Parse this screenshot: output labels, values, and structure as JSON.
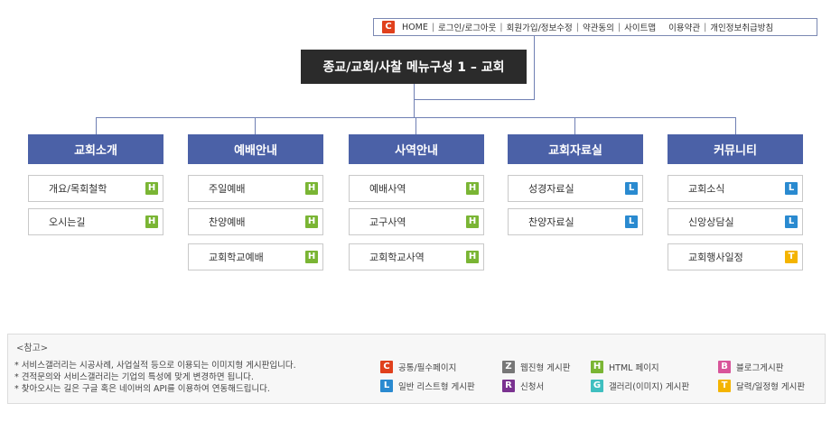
{
  "colors": {
    "C": "#e0401c",
    "H": "#7ab534",
    "L": "#2a8ad0",
    "T": "#f4b400",
    "Z": "#777777",
    "R": "#7a3290",
    "G": "#3fbfc0",
    "B": "#d8559a",
    "category": "#4b61a7",
    "title_bg": "#2b2b2b",
    "connector": "#6f7fb3"
  },
  "topbar": {
    "badge": "C",
    "links": [
      "HOME",
      "로그인/로그아웃",
      "회원가입/정보수정",
      "약관동의",
      "사이트맵"
    ],
    "extra_links": [
      "이용약관",
      "개인정보취급방침"
    ]
  },
  "title": "종교/교회/사찰 메뉴구성 1 – 교회",
  "categories": [
    {
      "label": "교회소개",
      "items": [
        {
          "label": "개요/목회철학",
          "badge": "H"
        },
        {
          "label": "오시는길",
          "badge": "H"
        }
      ]
    },
    {
      "label": "예배안내",
      "items": [
        {
          "label": "주일예배",
          "badge": "H"
        },
        {
          "label": "찬양예배",
          "badge": "H"
        },
        {
          "label": "교회학교예배",
          "badge": "H"
        }
      ]
    },
    {
      "label": "사역안내",
      "items": [
        {
          "label": "예배사역",
          "badge": "H"
        },
        {
          "label": "교구사역",
          "badge": "H"
        },
        {
          "label": "교회학교사역",
          "badge": "H"
        }
      ]
    },
    {
      "label": "교회자료실",
      "items": [
        {
          "label": "성경자료실",
          "badge": "L"
        },
        {
          "label": "찬양자료실",
          "badge": "L"
        }
      ]
    },
    {
      "label": "커뮤니티",
      "items": [
        {
          "label": "교회소식",
          "badge": "L"
        },
        {
          "label": "신앙상담실",
          "badge": "L"
        },
        {
          "label": "교회행사일정",
          "badge": "T"
        }
      ]
    }
  ],
  "reference": {
    "title": "<참고>",
    "notes": [
      "* 서비스갤러리는 시공사례, 사업실적 등으로 이용되는 이미지형 게시판입니다.",
      "* 견적문의와 서비스갤러리는 기업의 특성에 맞게 변경하면 됩니다.",
      "* 찾아오시는 길은 구글 혹은 네이버의 API를 이용하여 연동해드립니다."
    ],
    "legend": [
      {
        "badge": "C",
        "label": "공통/필수페이지"
      },
      {
        "badge": "Z",
        "label": "웹진형 게시판"
      },
      {
        "badge": "H",
        "label": "HTML 페이지"
      },
      {
        "badge": "B",
        "label": "블로그게시판"
      },
      {
        "badge": "L",
        "label": "일반 리스트형 게시판"
      },
      {
        "badge": "R",
        "label": "신청서"
      },
      {
        "badge": "G",
        "label": "갤러리(이미지) 게시판"
      },
      {
        "badge": "T",
        "label": "달력/일정형 게시판"
      }
    ]
  }
}
